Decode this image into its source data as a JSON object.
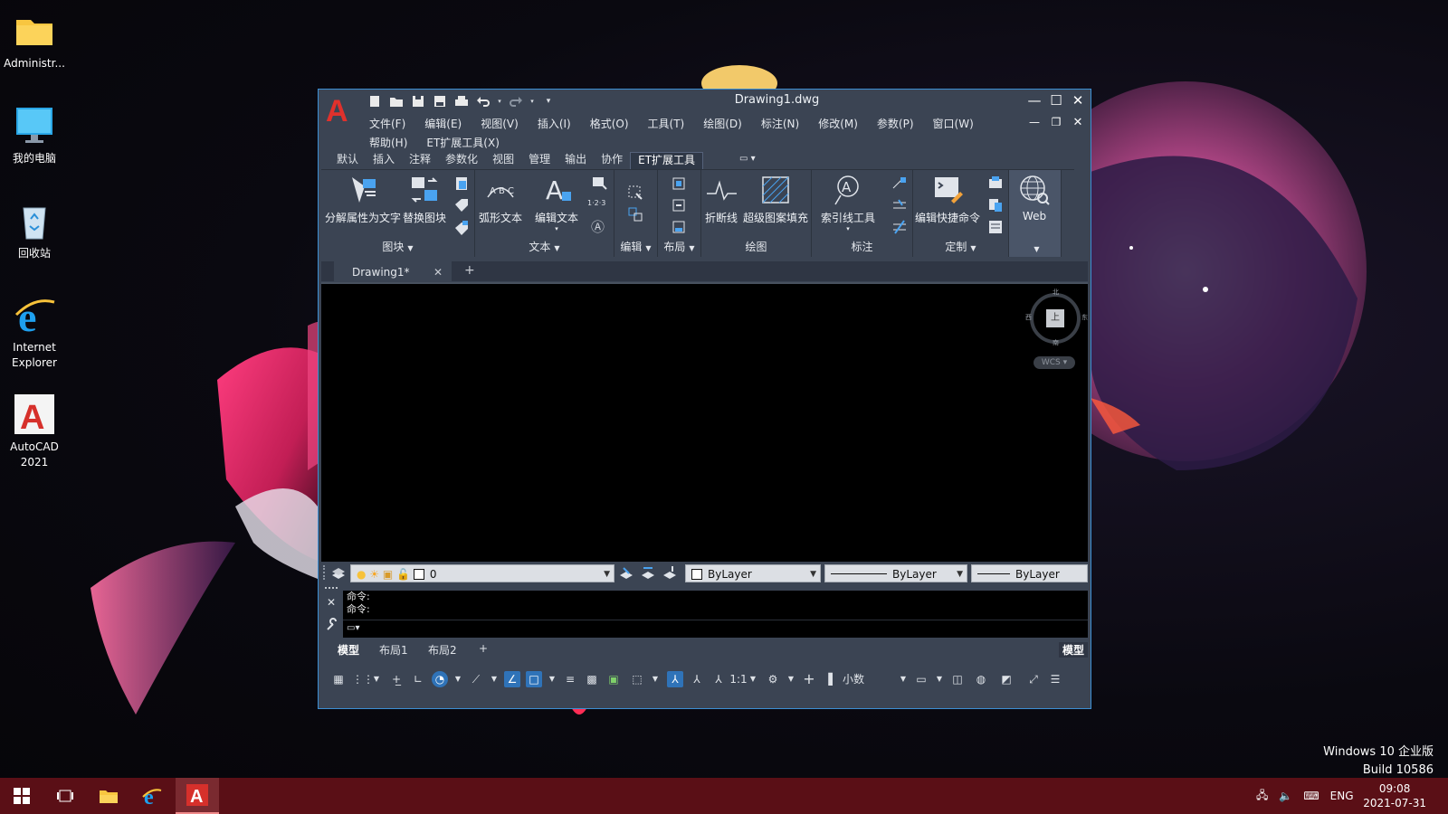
{
  "desktop": {
    "icons": [
      {
        "label": "Administr...",
        "icon": "folder-icon"
      },
      {
        "label": "我的电脑",
        "icon": "computer-icon"
      },
      {
        "label": "回收站",
        "icon": "recycle-bin-icon"
      },
      {
        "label": "Internet Explorer",
        "icon": "internet-explorer-icon"
      },
      {
        "label": "AutoCAD 2021",
        "icon": "autocad-icon"
      }
    ],
    "watermark": {
      "line1": "Windows 10 企业版",
      "line2": "Build 10586"
    }
  },
  "window": {
    "title": "Drawing1.dwg",
    "app_logo": "A",
    "menu_row1": [
      "文件(F)",
      "编辑(E)",
      "视图(V)",
      "插入(I)",
      "格式(O)",
      "工具(T)",
      "绘图(D)",
      "标注(N)",
      "修改(M)",
      "参数(P)",
      "窗口(W)"
    ],
    "menu_row2": [
      "帮助(H)",
      "ET扩展工具(X)"
    ],
    "ribbon_tabs": [
      "默认",
      "插入",
      "注释",
      "参数化",
      "视图",
      "管理",
      "输出",
      "协作",
      "ET扩展工具"
    ],
    "active_tab": "ET扩展工具",
    "ribbon": {
      "btn_explode_attr": "分解属性为文字",
      "btn_replace_block": "替换图块",
      "btn_arc_text": "弧形文本",
      "btn_edit_text": "编辑文本",
      "btn_break_line": "折断线",
      "btn_super_hatch": "超级图案填充",
      "btn_leader_tools": "索引线工具",
      "btn_edit_shortcut": "编辑快捷命令",
      "btn_web": "Web",
      "panel_block": "图块",
      "panel_text": "文本",
      "panel_edit": "编辑",
      "panel_layout": "布局",
      "panel_draw": "绘图",
      "panel_dim": "标注",
      "panel_custom": "定制",
      "small_text_123": "1·2·3",
      "small_text_A": "Ⓐ"
    },
    "doc_tab": {
      "label": "Drawing1*",
      "close": "✕",
      "add": "+"
    },
    "viewcube": {
      "face": "上",
      "north": "北",
      "south": "南",
      "east": "东",
      "west": "西",
      "wcs": "WCS"
    },
    "properties": {
      "layer": "0",
      "color": "ByLayer",
      "linetype": "ByLayer",
      "lineweight": "ByLayer"
    },
    "command_history": [
      "命令:",
      "命令:"
    ],
    "layout_tabs": [
      "模型",
      "布局1",
      "布局2"
    ],
    "layout_add": "+",
    "model_indicator": "模型",
    "status": {
      "scale": "1:1",
      "units": "小数"
    }
  },
  "taskbar": {
    "lang": "ENG",
    "time": "09:08",
    "date": "2021-07-31"
  },
  "colors": {
    "accent": "#3c8fd4",
    "taskbar": "#5a0f16",
    "ribbon_bg": "#3b4453",
    "autocad_red": "#e0312c"
  }
}
